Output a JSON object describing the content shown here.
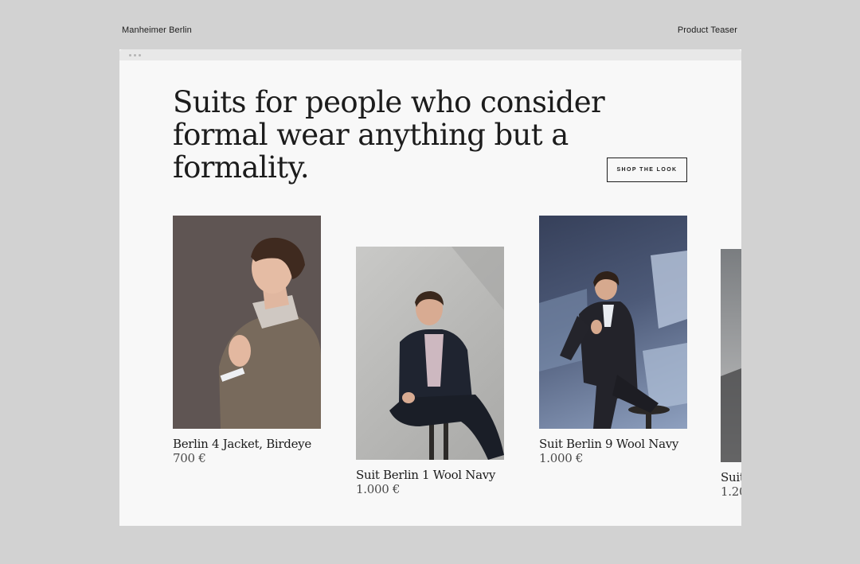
{
  "header": {
    "brand": "Manheimer Berlin",
    "page_label": "Product Teaser"
  },
  "hero": {
    "headline": "Suits for people who consider formal wear anything but a formality.",
    "cta_label": "SHOP THE LOOK"
  },
  "products": [
    {
      "name": "Berlin 4 Jacket, Birdeye",
      "price": "700 €",
      "image": "man-in-tweed-jacket-photo"
    },
    {
      "name": "Suit Berlin 1 Wool Navy",
      "price": "1.000 €",
      "image": "man-seated-navy-suit-photo"
    },
    {
      "name": "Suit Berlin 9 Wool Navy",
      "price": "1.000 €",
      "image": "man-double-breasted-suit-photo"
    },
    {
      "name": "Suit",
      "price": "1.20",
      "image": "partial-product-photo"
    }
  ]
}
